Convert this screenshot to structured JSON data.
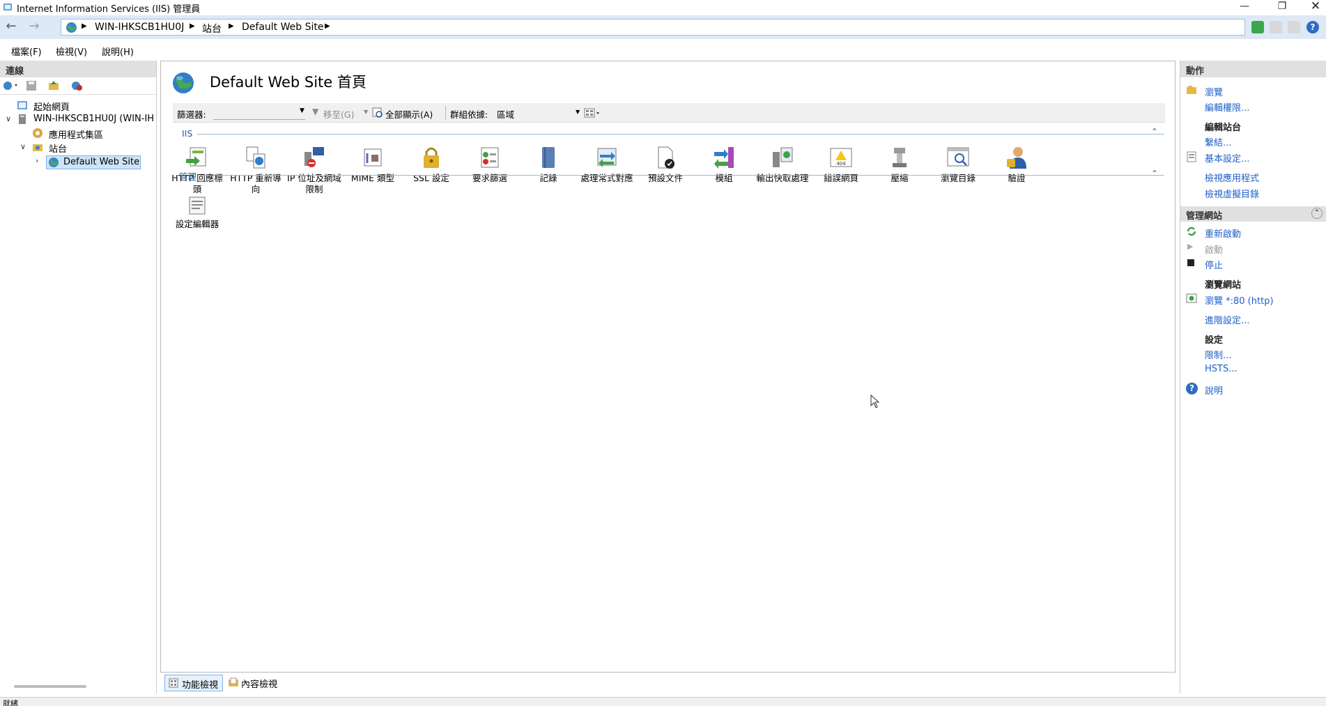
{
  "window": {
    "title": "Internet Information Services (IIS) 管理員"
  },
  "address": {
    "crumbs": [
      "WIN-IHKSCB1HU0J",
      "站台",
      "Default Web Site"
    ]
  },
  "menu": {
    "file": "檔案(F)",
    "view": "檢視(V)",
    "help": "說明(H)"
  },
  "connections": {
    "header": "連線",
    "tree": {
      "start_page": "起始網頁",
      "server": "WIN-IHKSCB1HU0J (WIN-IH",
      "app_pools": "應用程式集區",
      "sites": "站台",
      "default_site": "Default Web Site"
    }
  },
  "main": {
    "title": "Default Web Site 首頁",
    "filter_label": "篩選器:",
    "goto_label": "移至(G)",
    "show_all_label": "全部顯示(A)",
    "group_by_label": "群組依據:",
    "group_by_value": "區域",
    "groups": [
      {
        "label": "IIS",
        "features": [
          {
            "label": "HTTP 回應標頭"
          },
          {
            "label": "HTTP 重新導向"
          },
          {
            "label": "IP 位址及網域限制"
          },
          {
            "label": "MIME 類型"
          },
          {
            "label": "SSL 設定"
          },
          {
            "label": "要求篩選"
          },
          {
            "label": "記錄"
          },
          {
            "label": "處理常式對應"
          },
          {
            "label": "預設文件"
          },
          {
            "label": "模組"
          },
          {
            "label": "輸出快取處理"
          },
          {
            "label": "錯誤網頁"
          },
          {
            "label": "壓縮"
          },
          {
            "label": "瀏覽目錄"
          },
          {
            "label": "驗證"
          }
        ]
      },
      {
        "label": "管理",
        "features": [
          {
            "label": "設定編輯器"
          }
        ]
      }
    ]
  },
  "actions": {
    "header": "動作",
    "browse": "瀏覽",
    "edit_permissions": "編輯權限...",
    "edit_site_header": "編輯站台",
    "bindings": "繫結...",
    "basic_settings": "基本設定...",
    "view_apps": "檢視應用程式",
    "view_vdirs": "檢視虛擬目錄",
    "manage_site_header": "管理網站",
    "restart": "重新啟動",
    "start": "啟動",
    "stop": "停止",
    "browse_site_header": "瀏覽網站",
    "browse_80": "瀏覽 *:80 (http)",
    "advanced_settings": "進階設定...",
    "config_header": "設定",
    "limits": "限制...",
    "hsts": "HSTS...",
    "help": "說明"
  },
  "bottom_tabs": {
    "features_view": "功能檢視",
    "content_view": "內容檢視"
  },
  "status": {
    "text": "就緒"
  },
  "colors": {
    "link": "#1e5fc8",
    "group_label": "#2a5c96",
    "address_bg": "#dde9f6"
  }
}
